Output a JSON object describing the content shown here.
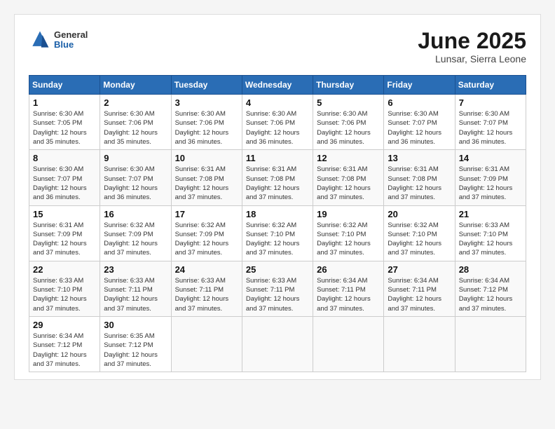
{
  "header": {
    "logo": {
      "general": "General",
      "blue": "Blue"
    },
    "title": "June 2025",
    "location": "Lunsar, Sierra Leone"
  },
  "weekdays": [
    "Sunday",
    "Monday",
    "Tuesday",
    "Wednesday",
    "Thursday",
    "Friday",
    "Saturday"
  ],
  "weeks": [
    [
      {
        "day": "1",
        "sunrise": "Sunrise: 6:30 AM",
        "sunset": "Sunset: 7:05 PM",
        "daylight": "Daylight: 12 hours and 35 minutes."
      },
      {
        "day": "2",
        "sunrise": "Sunrise: 6:30 AM",
        "sunset": "Sunset: 7:06 PM",
        "daylight": "Daylight: 12 hours and 35 minutes."
      },
      {
        "day": "3",
        "sunrise": "Sunrise: 6:30 AM",
        "sunset": "Sunset: 7:06 PM",
        "daylight": "Daylight: 12 hours and 36 minutes."
      },
      {
        "day": "4",
        "sunrise": "Sunrise: 6:30 AM",
        "sunset": "Sunset: 7:06 PM",
        "daylight": "Daylight: 12 hours and 36 minutes."
      },
      {
        "day": "5",
        "sunrise": "Sunrise: 6:30 AM",
        "sunset": "Sunset: 7:06 PM",
        "daylight": "Daylight: 12 hours and 36 minutes."
      },
      {
        "day": "6",
        "sunrise": "Sunrise: 6:30 AM",
        "sunset": "Sunset: 7:07 PM",
        "daylight": "Daylight: 12 hours and 36 minutes."
      },
      {
        "day": "7",
        "sunrise": "Sunrise: 6:30 AM",
        "sunset": "Sunset: 7:07 PM",
        "daylight": "Daylight: 12 hours and 36 minutes."
      }
    ],
    [
      {
        "day": "8",
        "sunrise": "Sunrise: 6:30 AM",
        "sunset": "Sunset: 7:07 PM",
        "daylight": "Daylight: 12 hours and 36 minutes."
      },
      {
        "day": "9",
        "sunrise": "Sunrise: 6:30 AM",
        "sunset": "Sunset: 7:07 PM",
        "daylight": "Daylight: 12 hours and 36 minutes."
      },
      {
        "day": "10",
        "sunrise": "Sunrise: 6:31 AM",
        "sunset": "Sunset: 7:08 PM",
        "daylight": "Daylight: 12 hours and 37 minutes."
      },
      {
        "day": "11",
        "sunrise": "Sunrise: 6:31 AM",
        "sunset": "Sunset: 7:08 PM",
        "daylight": "Daylight: 12 hours and 37 minutes."
      },
      {
        "day": "12",
        "sunrise": "Sunrise: 6:31 AM",
        "sunset": "Sunset: 7:08 PM",
        "daylight": "Daylight: 12 hours and 37 minutes."
      },
      {
        "day": "13",
        "sunrise": "Sunrise: 6:31 AM",
        "sunset": "Sunset: 7:08 PM",
        "daylight": "Daylight: 12 hours and 37 minutes."
      },
      {
        "day": "14",
        "sunrise": "Sunrise: 6:31 AM",
        "sunset": "Sunset: 7:09 PM",
        "daylight": "Daylight: 12 hours and 37 minutes."
      }
    ],
    [
      {
        "day": "15",
        "sunrise": "Sunrise: 6:31 AM",
        "sunset": "Sunset: 7:09 PM",
        "daylight": "Daylight: 12 hours and 37 minutes."
      },
      {
        "day": "16",
        "sunrise": "Sunrise: 6:32 AM",
        "sunset": "Sunset: 7:09 PM",
        "daylight": "Daylight: 12 hours and 37 minutes."
      },
      {
        "day": "17",
        "sunrise": "Sunrise: 6:32 AM",
        "sunset": "Sunset: 7:09 PM",
        "daylight": "Daylight: 12 hours and 37 minutes."
      },
      {
        "day": "18",
        "sunrise": "Sunrise: 6:32 AM",
        "sunset": "Sunset: 7:10 PM",
        "daylight": "Daylight: 12 hours and 37 minutes."
      },
      {
        "day": "19",
        "sunrise": "Sunrise: 6:32 AM",
        "sunset": "Sunset: 7:10 PM",
        "daylight": "Daylight: 12 hours and 37 minutes."
      },
      {
        "day": "20",
        "sunrise": "Sunrise: 6:32 AM",
        "sunset": "Sunset: 7:10 PM",
        "daylight": "Daylight: 12 hours and 37 minutes."
      },
      {
        "day": "21",
        "sunrise": "Sunrise: 6:33 AM",
        "sunset": "Sunset: 7:10 PM",
        "daylight": "Daylight: 12 hours and 37 minutes."
      }
    ],
    [
      {
        "day": "22",
        "sunrise": "Sunrise: 6:33 AM",
        "sunset": "Sunset: 7:10 PM",
        "daylight": "Daylight: 12 hours and 37 minutes."
      },
      {
        "day": "23",
        "sunrise": "Sunrise: 6:33 AM",
        "sunset": "Sunset: 7:11 PM",
        "daylight": "Daylight: 12 hours and 37 minutes."
      },
      {
        "day": "24",
        "sunrise": "Sunrise: 6:33 AM",
        "sunset": "Sunset: 7:11 PM",
        "daylight": "Daylight: 12 hours and 37 minutes."
      },
      {
        "day": "25",
        "sunrise": "Sunrise: 6:33 AM",
        "sunset": "Sunset: 7:11 PM",
        "daylight": "Daylight: 12 hours and 37 minutes."
      },
      {
        "day": "26",
        "sunrise": "Sunrise: 6:34 AM",
        "sunset": "Sunset: 7:11 PM",
        "daylight": "Daylight: 12 hours and 37 minutes."
      },
      {
        "day": "27",
        "sunrise": "Sunrise: 6:34 AM",
        "sunset": "Sunset: 7:11 PM",
        "daylight": "Daylight: 12 hours and 37 minutes."
      },
      {
        "day": "28",
        "sunrise": "Sunrise: 6:34 AM",
        "sunset": "Sunset: 7:12 PM",
        "daylight": "Daylight: 12 hours and 37 minutes."
      }
    ],
    [
      {
        "day": "29",
        "sunrise": "Sunrise: 6:34 AM",
        "sunset": "Sunset: 7:12 PM",
        "daylight": "Daylight: 12 hours and 37 minutes."
      },
      {
        "day": "30",
        "sunrise": "Sunrise: 6:35 AM",
        "sunset": "Sunset: 7:12 PM",
        "daylight": "Daylight: 12 hours and 37 minutes."
      },
      null,
      null,
      null,
      null,
      null
    ]
  ]
}
